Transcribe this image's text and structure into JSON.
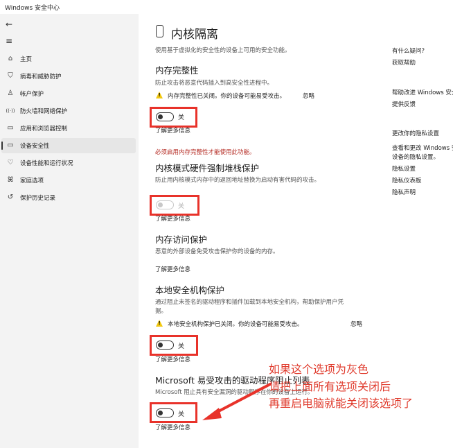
{
  "window": {
    "title": "Windows 安全中心"
  },
  "sidebar": {
    "back_icon": "back-arrow-icon",
    "menu_icon": "hamburger-menu-icon",
    "items": [
      {
        "label": "主页",
        "icon": "home-icon",
        "glyph": "⌂"
      },
      {
        "label": "病毒和威胁防护",
        "icon": "shield-icon",
        "glyph": "⛉"
      },
      {
        "label": "帐户保护",
        "icon": "account-icon",
        "glyph": "♙"
      },
      {
        "label": "防火墙和网络保护",
        "icon": "wifi-icon",
        "glyph": "((·))"
      },
      {
        "label": "应用和浏览器控制",
        "icon": "app-browser-icon",
        "glyph": "▭"
      },
      {
        "label": "设备安全性",
        "icon": "laptop-icon",
        "glyph": "▭",
        "active": true
      },
      {
        "label": "设备性能和运行状况",
        "icon": "heart-icon",
        "glyph": "♡"
      },
      {
        "label": "家庭选项",
        "icon": "family-icon",
        "glyph": "ꕤ"
      },
      {
        "label": "保护历史记录",
        "icon": "history-icon",
        "glyph": "↺"
      }
    ]
  },
  "main": {
    "title": "内核隔离",
    "title_icon": "chip-icon",
    "description": "使用基于虚拟化的安全性的设备上可用的安全功能。",
    "sections": {
      "memory_integrity": {
        "title": "内存完整性",
        "desc": "防止攻击将恶意代码插入到高安全性进程中。",
        "warning": "内存完整性已关闭。你的设备可能易受攻击。",
        "ignore": "忽略",
        "toggle_label": "关",
        "toggle_on": false,
        "learn_more": "了解更多信息"
      },
      "stack_protection": {
        "note": "必须启用内存完整性才能使用此功能。",
        "title": "内核模式硬件强制堆栈保护",
        "desc": "防止用内核模式内存中的返回地址替换为启动有害代码的攻击。",
        "toggle_label": "关",
        "toggle_on": false,
        "disabled": true,
        "learn_more": "了解更多信息"
      },
      "memory_access": {
        "title": "内存访问保护",
        "desc": "恶意的外部设备免受攻击保护你的设备的内存。",
        "learn_more": "了解更多信息"
      },
      "lsa": {
        "title": "本地安全机构保护",
        "desc_line1": "通过阻止未签名的驱动程序和插件加载到本地安全机构，帮助保护用户凭",
        "desc_line2": "据。",
        "warning": "本地安全机构保护已关闭。你的设备可能易受攻击。",
        "ignore": "忽略",
        "toggle_label": "关",
        "toggle_on": false,
        "learn_more": "了解更多信息"
      },
      "driver_blocklist": {
        "title": "Microsoft 易受攻击的驱动程序阻止列表",
        "desc": "Microsoft 阻止具有安全漏洞的驱动程序在你的设备上运行。",
        "toggle_label": "关",
        "toggle_on": false,
        "learn_more": "了解更多信息"
      }
    }
  },
  "right_panel": {
    "help_title": "有什么疑问?",
    "help_link": "获取帮助",
    "improve_title": "帮助改进 Windows 安全",
    "improve_link": "提供反馈",
    "privacy_title": "更改你的隐私设置",
    "privacy_desc_1": "查看和更改 Windows 安全",
    "privacy_desc_2": "设备的隐私设置。",
    "privacy_links": [
      "隐私设置",
      "隐私仪表板",
      "隐私声明"
    ]
  },
  "annotation": {
    "line1": "如果这个选项为灰色",
    "line2": "请把上面所有选项关闭后",
    "line3": "再重启电脑就能关闭该选项了",
    "color": "#e03b2d"
  }
}
